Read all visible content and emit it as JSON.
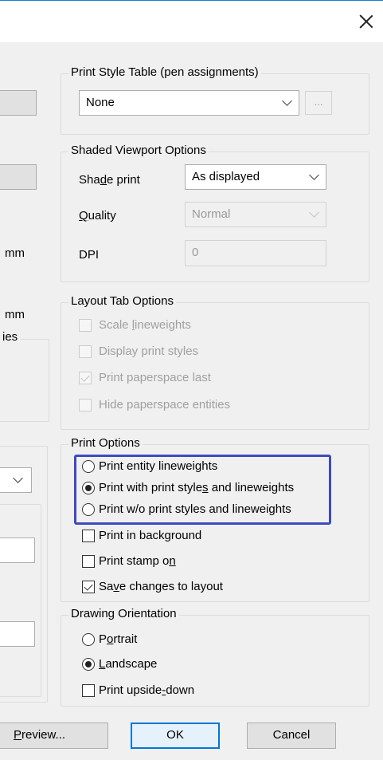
{
  "window": {
    "close_label": "Close"
  },
  "left_panel": {
    "unit_label_1": "mm",
    "unit_label_2": "mm",
    "group_fragment": "ies"
  },
  "print_style_table": {
    "title": "Print Style Table (pen assignments)",
    "selected": "None",
    "edit_button": "..."
  },
  "shaded_viewport": {
    "title": "Shaded Viewport Options",
    "shade_print": {
      "label_pre": "Sha",
      "label_u": "d",
      "label_post": "e print",
      "value": "As displayed"
    },
    "quality": {
      "label_u": "Q",
      "label_post": "uality",
      "value": "Normal"
    },
    "dpi": {
      "label": "DPI",
      "value": "0"
    }
  },
  "layout_tab": {
    "title": "Layout Tab Options",
    "items": [
      {
        "pre": "Scale ",
        "u": "l",
        "post": "ineweights",
        "checked": false
      },
      {
        "pre": "Display print styles",
        "u": "",
        "post": "",
        "checked": false
      },
      {
        "pre": "Print paperspace last",
        "u": "",
        "post": "",
        "checked": true
      },
      {
        "pre": "Hide paperspace entities",
        "u": "",
        "post": "",
        "checked": false
      }
    ]
  },
  "print_options": {
    "title": "Print Options",
    "radios": [
      {
        "pre": "Print entity lineweights",
        "u": "",
        "post": "",
        "selected": false
      },
      {
        "pre": "Print with print style",
        "u": "s",
        "post": " and lineweights",
        "selected": true
      },
      {
        "pre": "Print w/o print styles and lineweights",
        "u": "",
        "post": "",
        "selected": false
      }
    ],
    "checks": [
      {
        "pre": "Print in back",
        "u": "g",
        "post": "round",
        "checked": false
      },
      {
        "pre": "Print stamp o",
        "u": "n",
        "post": "",
        "checked": false
      },
      {
        "pre": "Sa",
        "u": "v",
        "post": "e changes to layout",
        "checked": true
      }
    ]
  },
  "drawing_orientation": {
    "title": "Drawing Orientation",
    "portrait": {
      "pre": "P",
      "u": "o",
      "post": "rtrait",
      "selected": false
    },
    "landscape": {
      "pre": "",
      "u": "L",
      "post": "andscape",
      "selected": true
    },
    "upside_down": {
      "pre": "Print upside",
      "u": "-",
      "post": "down",
      "checked": false
    }
  },
  "buttons": {
    "preview": {
      "u": "P",
      "post": "review..."
    },
    "ok": "OK",
    "cancel": "Cancel"
  },
  "colors": {
    "highlight": "#3d4ac0",
    "ok_border": "#0078d7",
    "title_line": "#1a7dd7"
  }
}
